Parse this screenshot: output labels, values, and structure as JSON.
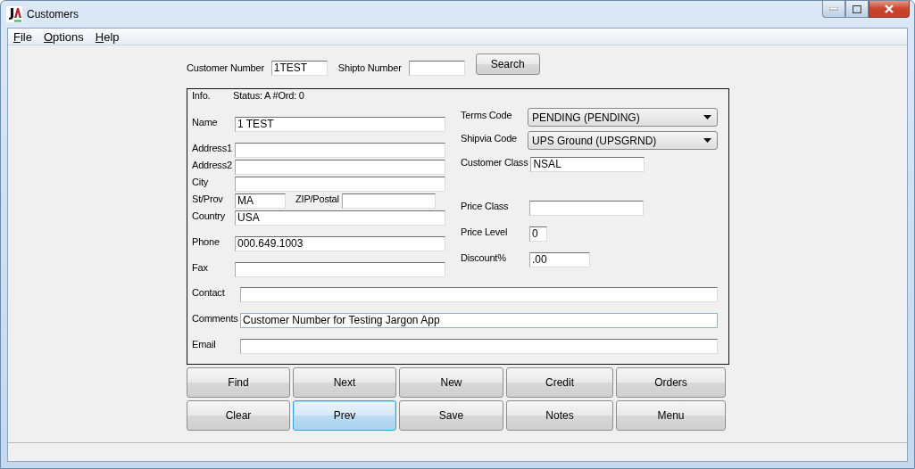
{
  "window": {
    "title": "Customers"
  },
  "menu": [
    {
      "label": "File"
    },
    {
      "label": "Options"
    },
    {
      "label": "Help"
    }
  ],
  "lookup": {
    "customer_number_label": "Customer Number",
    "customer_number": "1TEST",
    "shipto_label": "Shipto Number",
    "search_button": "Search"
  },
  "info": {
    "label": "Info.",
    "status": "Status: A #Ord: 0"
  },
  "left_fields": [
    {
      "kind": "text",
      "label": "Name",
      "value": "1 TEST"
    },
    {
      "kind": "text",
      "label": "Address1"
    },
    {
      "kind": "text",
      "label": "Address2"
    },
    {
      "kind": "text",
      "label": "City"
    },
    {
      "kind": "pair",
      "label": "St/Prov",
      "value": "MA",
      "second_label": "ZIP/Postal"
    },
    {
      "kind": "text",
      "label": "Country",
      "value": "USA"
    },
    {
      "kind": "text",
      "label": "Phone",
      "value": "000.649.1003"
    },
    {
      "kind": "text",
      "label": "Fax"
    }
  ],
  "right_fields": [
    {
      "kind": "dropdown",
      "label": "Terms Code",
      "value": "PENDING (PENDING)"
    },
    {
      "kind": "dropdown",
      "label": "Shipvia Code",
      "value": "UPS Ground (UPSGRND)"
    },
    {
      "kind": "text",
      "label": "Customer Class",
      "value": "NSAL"
    },
    {
      "kind": "text",
      "label": "Price Class"
    },
    {
      "kind": "short",
      "label": "Price Level",
      "value": "0"
    },
    {
      "kind": "medium",
      "label": "Discount%",
      "value": ".00"
    }
  ],
  "wide_fields": [
    {
      "label": "Contact",
      "focused": false
    },
    {
      "label": "Comments",
      "value": "Customer Number for Testing Jargon App",
      "focused": true
    },
    {
      "label": "Email",
      "focused": false
    }
  ],
  "buttons": [
    [
      {
        "label": "Find",
        "selected": false
      },
      {
        "label": "Next",
        "selected": false
      },
      {
        "label": "New",
        "selected": false
      },
      {
        "label": "Credit",
        "selected": false
      },
      {
        "label": "Orders",
        "selected": false
      }
    ],
    [
      {
        "label": "Clear",
        "selected": false
      },
      {
        "label": "Prev",
        "selected": true
      },
      {
        "label": "Save",
        "selected": false
      },
      {
        "label": "Notes",
        "selected": false
      },
      {
        "label": "Menu",
        "selected": false
      }
    ]
  ]
}
